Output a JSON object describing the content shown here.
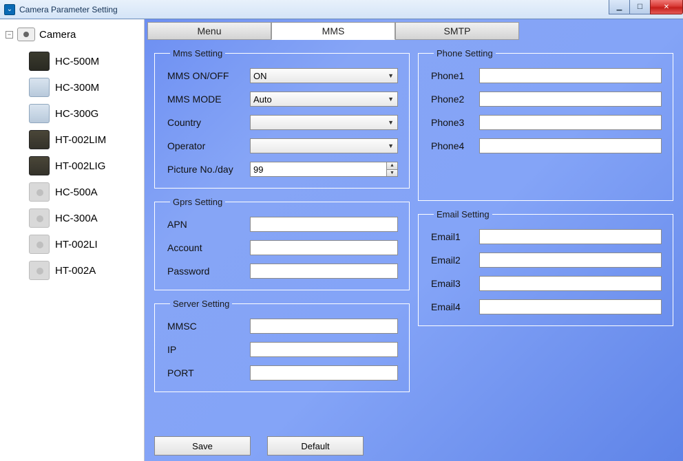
{
  "window": {
    "title": "Camera Parameter Setting"
  },
  "tree": {
    "root": "Camera",
    "items": [
      "HC-500M",
      "HC-300M",
      "HC-300G",
      "HT-002LIM",
      "HT-002LIG",
      "HC-500A",
      "HC-300A",
      "HT-002LI",
      "HT-002A"
    ]
  },
  "tabs": {
    "menu": "Menu",
    "mms": "MMS",
    "smtp": "SMTP"
  },
  "mms": {
    "legend": "Mms Setting",
    "onoff_label": "MMS ON/OFF",
    "onoff_value": "ON",
    "mode_label": "MMS MODE",
    "mode_value": "Auto",
    "country_label": "Country",
    "country_value": "",
    "operator_label": "Operator",
    "operator_value": "",
    "picno_label": "Picture No./day",
    "picno_value": "99"
  },
  "gprs": {
    "legend": "Gprs Setting",
    "apn_label": "APN",
    "apn_value": "",
    "account_label": "Account",
    "account_value": "",
    "password_label": "Password",
    "password_value": ""
  },
  "server": {
    "legend": "Server Setting",
    "mmsc_label": "MMSC",
    "mmsc_value": "",
    "ip_label": "IP",
    "ip_value": "",
    "port_label": "PORT",
    "port_value": ""
  },
  "phone": {
    "legend": "Phone Setting",
    "p1_label": "Phone1",
    "p1_value": "",
    "p2_label": "Phone2",
    "p2_value": "",
    "p3_label": "Phone3",
    "p3_value": "",
    "p4_label": "Phone4",
    "p4_value": ""
  },
  "email": {
    "legend": "Email Setting",
    "e1_label": "Email1",
    "e1_value": "",
    "e2_label": "Email2",
    "e2_value": "",
    "e3_label": "Email3",
    "e3_value": "",
    "e4_label": "Email4",
    "e4_value": ""
  },
  "buttons": {
    "save": "Save",
    "default": "Default"
  }
}
